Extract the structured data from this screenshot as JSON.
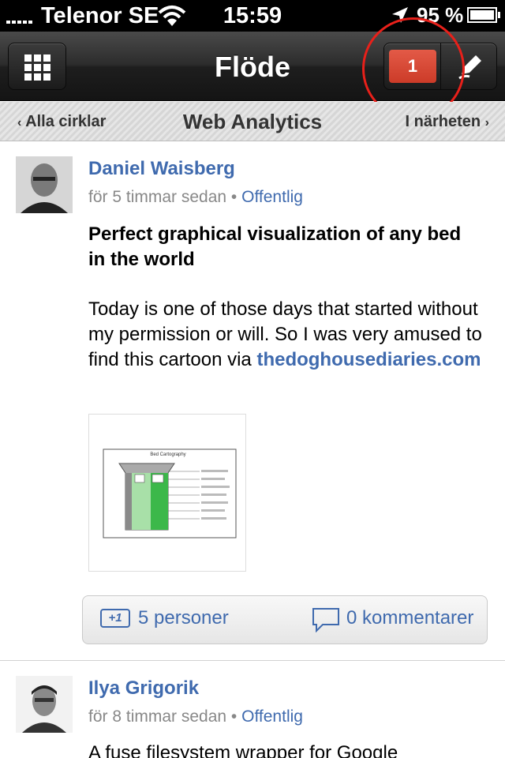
{
  "status_bar": {
    "carrier": "Telenor SE",
    "time": "15:59",
    "battery_percent": "95 %",
    "battery_level": 0.95,
    "icons": [
      "signal-icon",
      "wifi-icon",
      "location-icon",
      "battery-icon"
    ]
  },
  "nav": {
    "title": "Flöde",
    "notification_count": "1",
    "left_icon": "apps-grid-icon",
    "right_icon": "compose-icon"
  },
  "circles": {
    "prev": "Alla cirklar",
    "current": "Web Analytics",
    "next": "I närheten"
  },
  "posts": [
    {
      "author": "Daniel Waisberg",
      "time": "för 5 timmar sedan",
      "visibility": "Offentlig",
      "title": "Perfect graphical visualization of any bed in the world",
      "body": "Today is one of those days that started without my permission or will. So I was very amused to find this cartoon via",
      "link": "thedoghousediaries.com",
      "thumbnail_title": "Bed Cartography",
      "plus_one_label": "+1",
      "plus_one_count": "5 personer",
      "comment_count": "0 kommentarer"
    },
    {
      "author": "Ilya Grigorik",
      "time": "för 8 timmar sedan",
      "visibility": "Offentlig",
      "title": "A fuse filesystem wrapper for Google"
    }
  ],
  "colors": {
    "link": "#3f6aae",
    "badge": "#d84a36",
    "highlight_ring": "#e8201a"
  }
}
